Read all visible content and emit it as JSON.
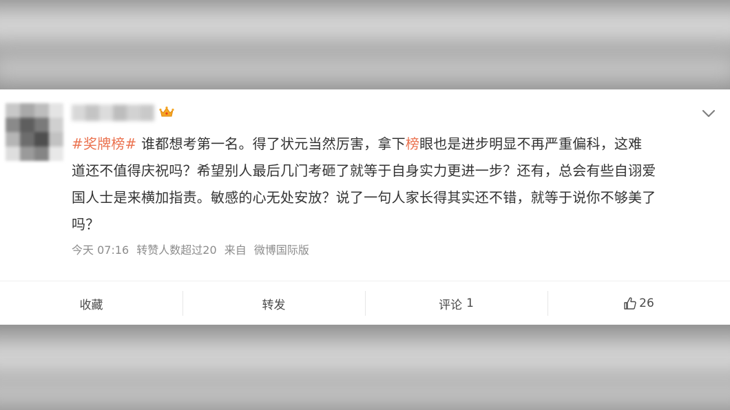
{
  "post": {
    "hashtag": "#奖牌榜#",
    "text_lines": [
      "谁都想考第一名。得了状元当然厉害，拿下",
      "榜",
      "眼也是进步明显不再严重偏科，这难",
      "道还不值得庆祝吗？希望别人最后几门考砸了就等于自身实力更进一步？还有，总会有些自诩爱",
      "国人士是来横加指责。敏感的心无处安放？说了一句人家长得其实还不错，就等于说你不够美了",
      "吗？"
    ]
  },
  "meta": {
    "time": "今天 07:16",
    "reposts": "转赞人数超过20",
    "source_prefix": "来自",
    "source": "微博国际版"
  },
  "actions": {
    "favorite": "收藏",
    "repost": "转发",
    "comment": "评论",
    "comment_count": "1",
    "like_count": "26"
  },
  "icons": {
    "badge": "crown-icon",
    "menu": "chevron-down-icon",
    "like": "thumb-up-icon"
  },
  "colors": {
    "accent": "#eb7350",
    "text": "#333333",
    "meta": "#8c8c8c"
  }
}
